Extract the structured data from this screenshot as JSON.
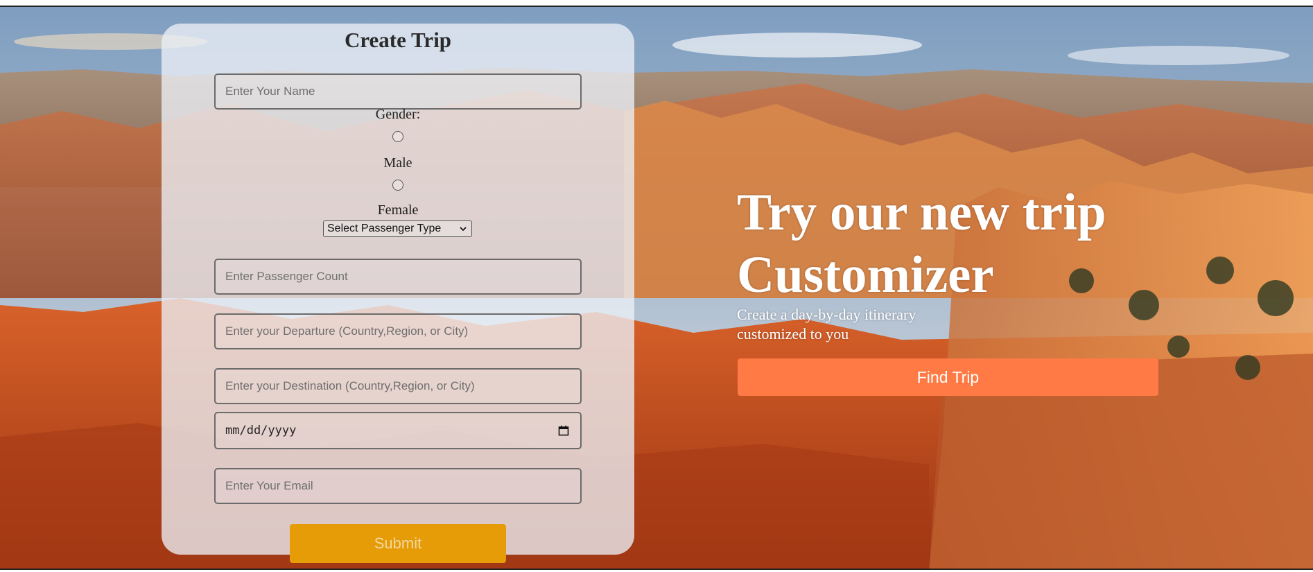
{
  "form": {
    "title": "Create Trip",
    "name_placeholder": "Enter Your Name",
    "gender_label": "Gender:",
    "gender_options": [
      "Male",
      "Female"
    ],
    "passenger_type_selected": "Select Passenger Type",
    "passenger_count_placeholder": "Enter Passenger Count",
    "departure_placeholder": "Enter your Departure (Country,Region, or City)",
    "destination_placeholder": "Enter your Destination (Country,Region, or City)",
    "date_placeholder": "mm/dd/yyyy",
    "email_placeholder": "Enter Your Email",
    "submit_label": "Submit"
  },
  "hero": {
    "heading_line1": "Try our new trip",
    "heading_line2": "Customizer",
    "subtext_line1": "Create a day-by-day itinerary",
    "subtext_line2": "customized to you",
    "button_label": "Find Trip"
  },
  "icons": {
    "select_chevron": "chevron-down-icon",
    "date_picker": "calendar-icon"
  },
  "colors": {
    "submit_button": "#e69c07",
    "find_trip_button": "#ff7a45",
    "form_card": "#eceff6"
  }
}
